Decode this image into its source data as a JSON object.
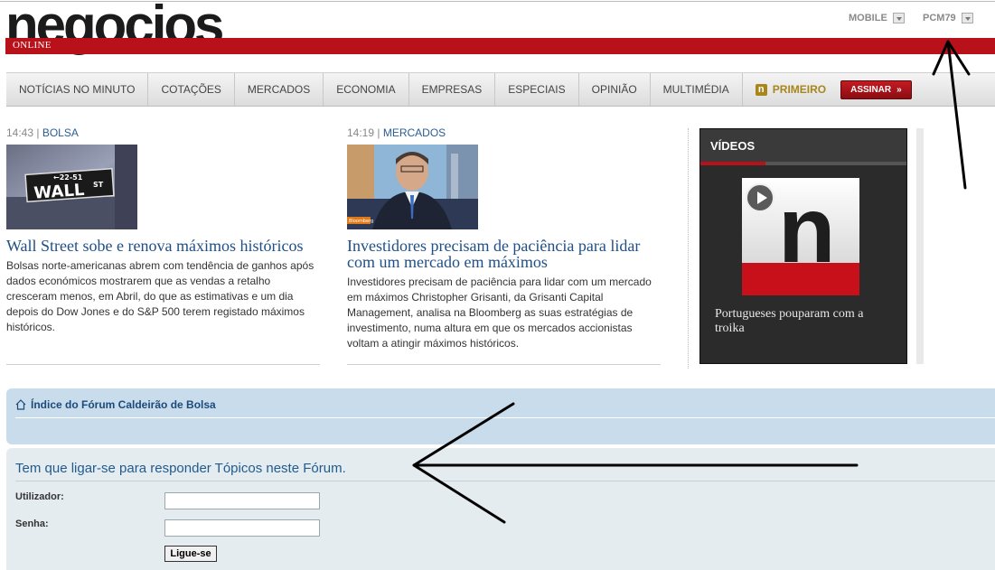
{
  "header": {
    "logo_text": "negocios",
    "tagline": "ONLINE",
    "links": [
      {
        "label": "MOBILE"
      },
      {
        "label": "PCM79"
      }
    ]
  },
  "nav": {
    "items": [
      {
        "label": "NOTÍCIAS NO MINUTO"
      },
      {
        "label": "COTAÇÕES"
      },
      {
        "label": "MERCADOS"
      },
      {
        "label": "ECONOMIA"
      },
      {
        "label": "EMPRESAS"
      },
      {
        "label": "ESPECIAIS"
      },
      {
        "label": "OPINIÃO"
      },
      {
        "label": "MULTIMÉDIA"
      }
    ],
    "primeiro_label": "PRIMEIRO",
    "primeiro_icon_letter": "n",
    "assinar_label": "ASSINAR",
    "assinar_icon": "»"
  },
  "articles": [
    {
      "time": "14:43",
      "category": "BOLSA",
      "title": "Wall Street sobe e renova máximos históricos",
      "body": "Bolsas norte-americanas abrem com tendência de ganhos após dados económicos mostrarem que as vendas a retalho cresceram menos, em Abril, do que as estimativas e um dia depois do Dow Jones e do S&P 500 terem registado máximos históricos.",
      "image_sign_text": "WALL",
      "image_sign_sup": "ST",
      "image_sign_arrow": "←22-51"
    },
    {
      "time": "14:19",
      "category": "MERCADOS",
      "title": "Investidores precisam de paciência para lidar com um mercado em máximos",
      "body": "Investidores precisam de paciência para lidar com um mercado em máximos Christopher Grisanti, da Grisanti Capital Management, analisa na Bloomberg as suas estratégias de investimento, numa altura em que os mercados accionistas voltam a atingir máximos históricos.",
      "image_badge": "Bloomberg"
    }
  ],
  "videos": {
    "title": "VÍDEOS",
    "thumb_letter": "n",
    "caption": "Portugueses pouparam com a troika"
  },
  "forum": {
    "breadcrumb": "Índice do Fórum Caldeirão de Bolsa",
    "login_prompt": "Tem que ligar-se para responder Tópicos neste Fórum.",
    "username_label": "Utilizador:",
    "username_value": "",
    "password_label": "Senha:",
    "password_value": "",
    "submit_label": "Ligue-se"
  },
  "colors": {
    "brand_red": "#b8111a",
    "link_blue": "#1f4f86",
    "forum_blue": "#c9dcec"
  }
}
